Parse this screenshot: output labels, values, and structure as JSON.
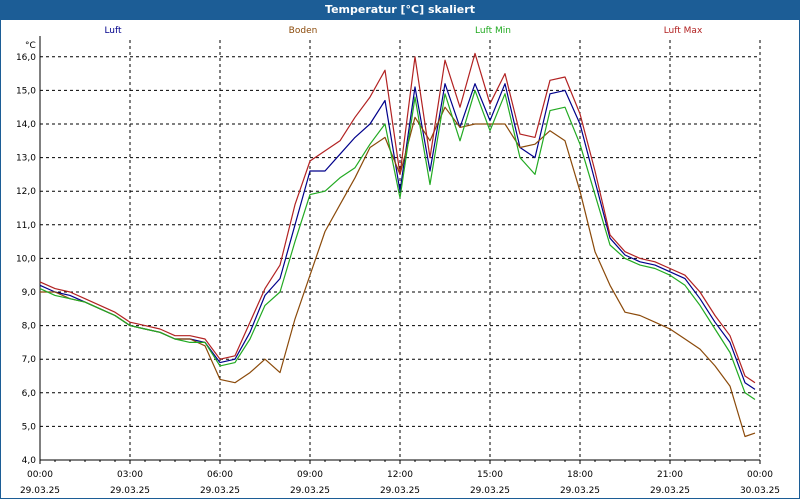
{
  "chart_data": {
    "type": "line",
    "title": "Temperatur [°C] skaliert",
    "ylabel": "°C",
    "ylim": [
      4.0,
      16.5
    ],
    "xlim": [
      "2025-03-29T00:00",
      "2025-03-30T00:00"
    ],
    "grid": true,
    "legend_position": "top",
    "yticks": [
      "4,0",
      "5,0",
      "6,0",
      "7,0",
      "8,0",
      "9,0",
      "10,0",
      "11,0",
      "12,0",
      "13,0",
      "14,0",
      "15,0",
      "16,0"
    ],
    "xticks": [
      {
        "time": "00:00",
        "date": "29.03.25"
      },
      {
        "time": "03:00",
        "date": "29.03.25"
      },
      {
        "time": "06:00",
        "date": "29.03.25"
      },
      {
        "time": "09:00",
        "date": "29.03.25"
      },
      {
        "time": "12:00",
        "date": "29.03.25"
      },
      {
        "time": "15:00",
        "date": "29.03.25"
      },
      {
        "time": "18:00",
        "date": "29.03.25"
      },
      {
        "time": "21:00",
        "date": "29.03.25"
      },
      {
        "time": "00:00",
        "date": "30.03.25"
      }
    ],
    "x": [
      "2025-03-29T00:00",
      "2025-03-29T00:30",
      "2025-03-29T01:00",
      "2025-03-29T01:30",
      "2025-03-29T02:00",
      "2025-03-29T02:30",
      "2025-03-29T03:00",
      "2025-03-29T03:30",
      "2025-03-29T04:00",
      "2025-03-29T04:30",
      "2025-03-29T05:00",
      "2025-03-29T05:30",
      "2025-03-29T06:00",
      "2025-03-29T06:30",
      "2025-03-29T07:00",
      "2025-03-29T07:30",
      "2025-03-29T08:00",
      "2025-03-29T08:30",
      "2025-03-29T09:00",
      "2025-03-29T09:30",
      "2025-03-29T10:00",
      "2025-03-29T10:30",
      "2025-03-29T11:00",
      "2025-03-29T11:30",
      "2025-03-29T12:00",
      "2025-03-29T12:30",
      "2025-03-29T13:00",
      "2025-03-29T13:30",
      "2025-03-29T14:00",
      "2025-03-29T14:30",
      "2025-03-29T15:00",
      "2025-03-29T15:30",
      "2025-03-29T16:00",
      "2025-03-29T16:30",
      "2025-03-29T17:00",
      "2025-03-29T17:30",
      "2025-03-29T18:00",
      "2025-03-29T18:30",
      "2025-03-29T19:00",
      "2025-03-29T19:30",
      "2025-03-29T20:00",
      "2025-03-29T20:30",
      "2025-03-29T21:00",
      "2025-03-29T21:30",
      "2025-03-29T22:00",
      "2025-03-29T22:30",
      "2025-03-29T23:00",
      "2025-03-29T23:30",
      "2025-03-29T23:50"
    ],
    "series": [
      {
        "name": "Luft",
        "color": "#00008b",
        "values": [
          9.2,
          9.0,
          8.9,
          8.7,
          8.5,
          8.3,
          8.0,
          7.9,
          7.8,
          7.6,
          7.6,
          7.5,
          6.9,
          7.0,
          7.8,
          8.9,
          9.4,
          11.0,
          12.6,
          12.6,
          13.1,
          13.6,
          14.0,
          14.7,
          12.0,
          15.1,
          12.6,
          15.2,
          13.9,
          15.2,
          14.1,
          15.2,
          13.3,
          13.0,
          14.9,
          15.0,
          14.0,
          12.3,
          10.6,
          10.1,
          9.9,
          9.8,
          9.6,
          9.4,
          8.8,
          8.1,
          7.5,
          6.3,
          6.1
        ]
      },
      {
        "name": "Boden",
        "color": "#8b4a0a",
        "values": [
          9.0,
          9.0,
          8.8,
          8.7,
          8.5,
          8.3,
          8.0,
          7.9,
          7.8,
          7.6,
          7.6,
          7.4,
          6.4,
          6.3,
          6.6,
          7.0,
          6.6,
          8.2,
          9.5,
          10.8,
          11.6,
          12.4,
          13.3,
          13.6,
          12.5,
          14.2,
          13.5,
          14.5,
          13.9,
          14.0,
          14.0,
          14.0,
          13.3,
          13.4,
          13.8,
          13.5,
          12.0,
          10.2,
          9.2,
          8.4,
          8.3,
          8.1,
          7.9,
          7.6,
          7.3,
          6.8,
          6.2,
          4.7,
          4.8
        ]
      },
      {
        "name": "Luft Min",
        "color": "#22aa22",
        "values": [
          9.1,
          8.9,
          8.8,
          8.7,
          8.5,
          8.3,
          8.0,
          7.9,
          7.8,
          7.6,
          7.5,
          7.5,
          6.8,
          6.9,
          7.6,
          8.6,
          9.0,
          10.5,
          11.9,
          12.0,
          12.4,
          12.7,
          13.4,
          14.0,
          11.8,
          14.8,
          12.2,
          14.9,
          13.5,
          15.0,
          13.8,
          14.9,
          13.0,
          12.5,
          14.4,
          14.5,
          13.4,
          11.9,
          10.4,
          10.0,
          9.8,
          9.7,
          9.5,
          9.2,
          8.6,
          7.9,
          7.2,
          6.0,
          5.8
        ]
      },
      {
        "name": "Luft Max",
        "color": "#b22222",
        "values": [
          9.3,
          9.1,
          9.0,
          8.8,
          8.6,
          8.4,
          8.1,
          8.0,
          7.9,
          7.7,
          7.7,
          7.6,
          7.0,
          7.1,
          8.1,
          9.1,
          9.8,
          11.6,
          12.9,
          13.2,
          13.5,
          14.2,
          14.8,
          15.6,
          12.5,
          16.0,
          13.0,
          15.9,
          14.5,
          16.1,
          14.6,
          15.5,
          13.7,
          13.6,
          15.3,
          15.4,
          14.3,
          12.6,
          10.7,
          10.2,
          10.0,
          9.9,
          9.7,
          9.5,
          9.0,
          8.3,
          7.7,
          6.5,
          6.3
        ]
      }
    ]
  }
}
